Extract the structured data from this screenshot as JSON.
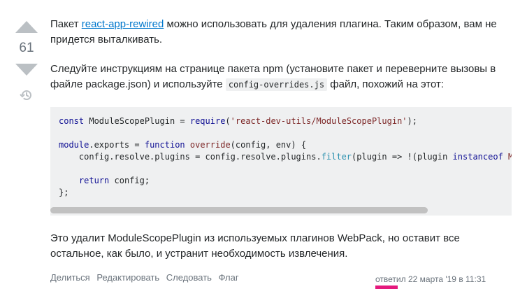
{
  "vote": {
    "count": "61",
    "upvote_icon": "arrow-up-icon",
    "downvote_icon": "arrow-down-icon",
    "history_icon": "history-icon"
  },
  "answer": {
    "para1": {
      "before": "Пакет ",
      "link": "react-app-rewired",
      "after": " можно использовать для удаления плагина. Таким образом, вам не придется выталкивать."
    },
    "para2": {
      "before": "Следуйте инструкциям на странице пакета npm (установите пакет и переверните вызовы в файле package.json) и используйте ",
      "code": "config-overrides.js",
      "after": " файл, похожий на этот:"
    },
    "para3": "Это удалит ModuleScopePlugin из используемых плагинов WebPack, но оставит все остальное, как было, и устранит необходимость извлечения."
  },
  "menu": {
    "share": "Делиться",
    "edit": "Редактировать",
    "follow": "Следовать",
    "flag": "Флаг"
  },
  "user": {
    "answered": "ответил 22 марта '19 в 11:31"
  },
  "colors": {
    "link": "#0077cc",
    "code_bg": "#eff0f1",
    "vote_arrow": "#bbc0c4"
  }
}
